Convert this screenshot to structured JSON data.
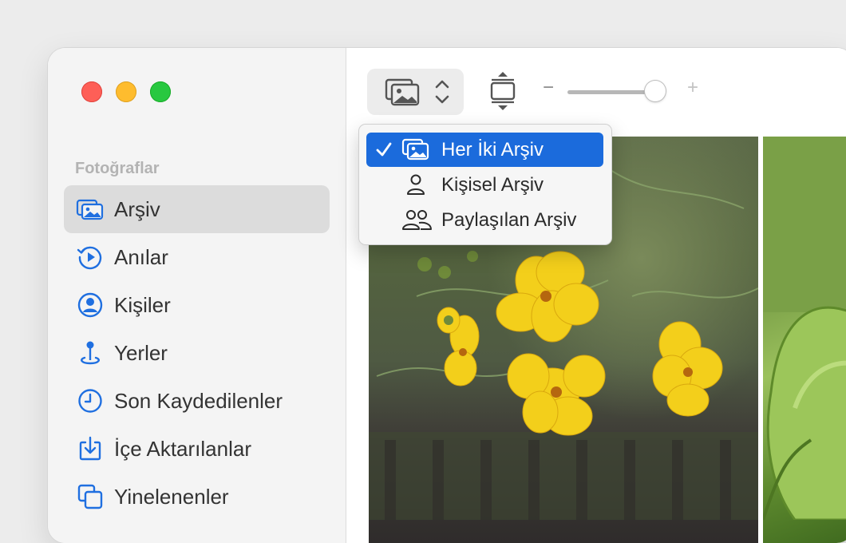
{
  "window": {
    "controls": [
      "close",
      "minimize",
      "zoom"
    ]
  },
  "sidebar": {
    "section_header": "Fotoğraflar",
    "items": [
      {
        "label": "Arşiv",
        "icon": "photo-library-icon",
        "selected": true
      },
      {
        "label": "Anılar",
        "icon": "memories-icon",
        "selected": false
      },
      {
        "label": "Kişiler",
        "icon": "person-circle-icon",
        "selected": false
      },
      {
        "label": "Yerler",
        "icon": "map-pin-icon",
        "selected": false
      },
      {
        "label": "Son Kaydedilenler",
        "icon": "clock-icon",
        "selected": false
      },
      {
        "label": "İçe Aktarılanlar",
        "icon": "import-icon",
        "selected": false
      },
      {
        "label": "Yinelenenler",
        "icon": "duplicates-icon",
        "selected": false
      }
    ]
  },
  "toolbar": {
    "library_switcher_icon": "photo-library-icon",
    "zoom_minus": "−",
    "zoom_plus": "+",
    "zoom_level": 0.92
  },
  "dropdown": {
    "items": [
      {
        "label": "Her İki Arşiv",
        "icon": "both-libraries-icon",
        "checked": true
      },
      {
        "label": "Kişisel Arşiv",
        "icon": "person-icon",
        "checked": false
      },
      {
        "label": "Paylaşılan Arşiv",
        "icon": "shared-people-icon",
        "checked": false
      }
    ]
  },
  "colors": {
    "accent": "#1b6bdc",
    "sidebar_icon": "#1f6fe0",
    "close": "#fe5f57",
    "minimize": "#febc2e",
    "zoom": "#28c840"
  }
}
